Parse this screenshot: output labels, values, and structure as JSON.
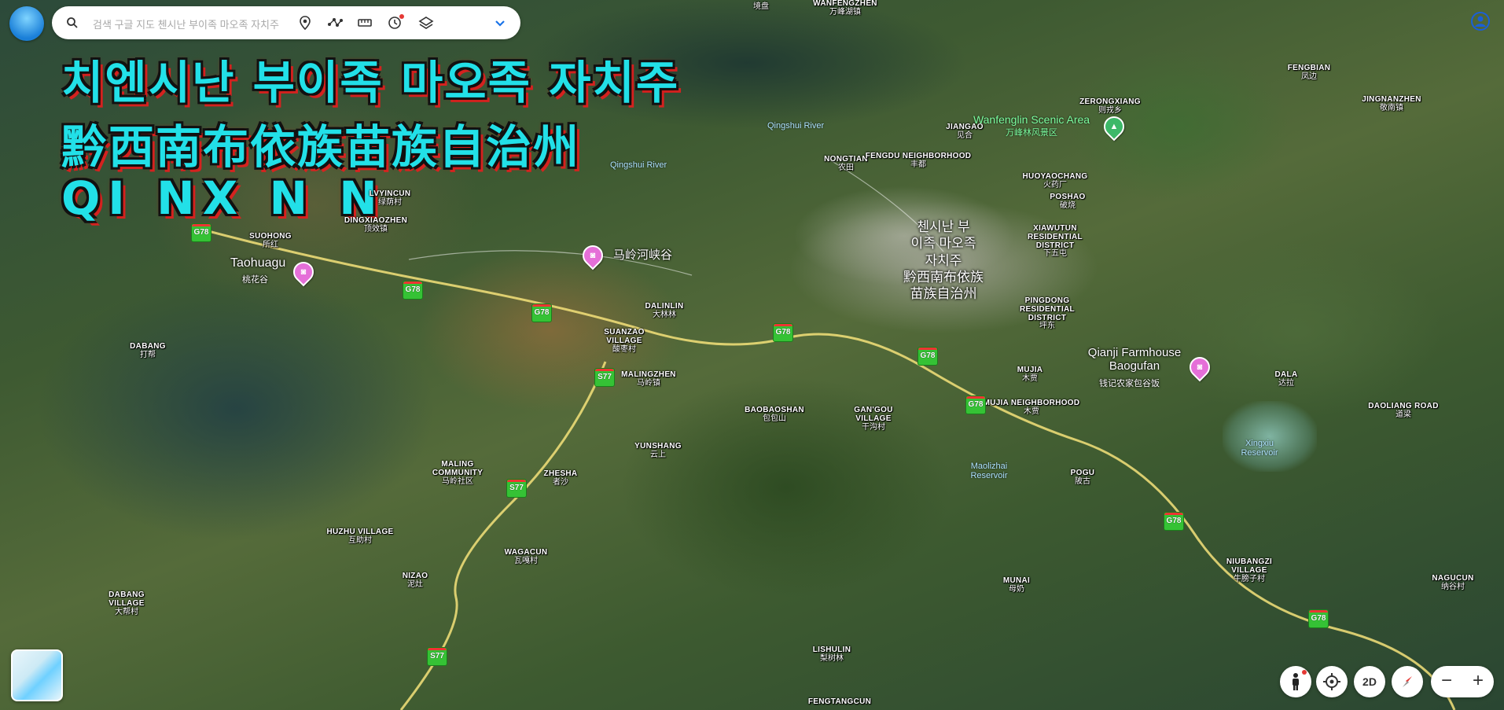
{
  "search": {
    "placeholder": "검색 구글 지도 첸시난 부이족 마오족 자치주"
  },
  "overlay_title": {
    "line1": "치엔시난 부이족 마오족 자치주",
    "line2": "黔西南布依族苗族自治州",
    "line3": "QI NX  N N"
  },
  "city_label": {
    "ko_1": "첸시난 부",
    "ko_2": "이족 마오족",
    "ko_3": "자치주",
    "zh_1": "黔西南布依族",
    "zh_2": "苗族自治州"
  },
  "places": [
    {
      "en": "WANFENGZHEN",
      "zh": "万峰湖镇"
    },
    {
      "en": "",
      "zh": "境盘"
    },
    {
      "en": "FENGBIAN",
      "zh": "凤边"
    },
    {
      "en": "JINGNANZHEN",
      "zh": "敬南镇"
    },
    {
      "en": "ZERONGXIANG",
      "zh": "则戎乡"
    },
    {
      "en": "JIANGAO",
      "zh": "见合"
    },
    {
      "en": "NONGTIAN",
      "zh": "农田"
    },
    {
      "en": "FENGDU NEIGHBORHOOD",
      "zh": "丰都"
    },
    {
      "en": "HUOYAOCHANG",
      "zh": "火药厂"
    },
    {
      "en": "POSHAO",
      "zh": "破烧"
    },
    {
      "en": "XIAWUTUN RESIDENTIAL DISTRICT",
      "zh": "下五屯"
    },
    {
      "en": "LVYINCUN",
      "zh": "绿荫村"
    },
    {
      "en": "DINGXIAOZHEN",
      "zh": "顶效镇"
    },
    {
      "en": "SUOHONG",
      "zh": "所红"
    },
    {
      "en": "DALINLIN",
      "zh": "大林林"
    },
    {
      "en": "SUANZAO VILLAGE",
      "zh": "酸枣村"
    },
    {
      "en": "MALINGZHEN",
      "zh": "马岭镇"
    },
    {
      "en": "PINGDONG RESIDENTIAL DISTRICT",
      "zh": "坪东"
    },
    {
      "en": "MUJIA",
      "zh": "木贾"
    },
    {
      "en": "MUJIA NEIGHBORHOOD",
      "zh": "木贾"
    },
    {
      "en": "DABANG",
      "zh": "打帮"
    },
    {
      "en": "BAOBAOSHAN",
      "zh": "包包山"
    },
    {
      "en": "GAN'GOU VILLAGE",
      "zh": "干沟村"
    },
    {
      "en": "YUNSHANG",
      "zh": "云上"
    },
    {
      "en": "MALING COMMUNITY",
      "zh": "马岭社区"
    },
    {
      "en": "ZHESHA",
      "zh": "者沙"
    },
    {
      "en": "DALA",
      "zh": "达拉"
    },
    {
      "en": "DAOLIANG ROAD",
      "zh": "道梁"
    },
    {
      "en": "POGU",
      "zh": "陂古"
    },
    {
      "en": "HUZHU VILLAGE",
      "zh": "互助村"
    },
    {
      "en": "WAGACUN",
      "zh": "瓦嘎村"
    },
    {
      "en": "NIZAO",
      "zh": "泥灶"
    },
    {
      "en": "DABANG VILLAGE",
      "zh": "大帮村"
    },
    {
      "en": "MUNAI",
      "zh": "母奶"
    },
    {
      "en": "NIUBANGZI VILLAGE",
      "zh": "牛膀子村"
    },
    {
      "en": "NAGUCUN",
      "zh": "纳谷村"
    },
    {
      "en": "LISHULIN",
      "zh": "梨树林"
    },
    {
      "en": "FENGTANGCUN",
      "zh": ""
    }
  ],
  "water": [
    "Qingshui River",
    "Qingshui River",
    "Xingxiu Reservoir",
    "Maolizhai Reservoir"
  ],
  "scenic": {
    "en": "Wanfenglin Scenic Area",
    "zh": "万峰林风景区"
  },
  "pois": [
    {
      "label": "Taohuagu",
      "sub": "桃花谷"
    },
    {
      "label": "马岭河峡谷",
      "sub": ""
    },
    {
      "label": "Qianji Farmhouse Baogufan",
      "sub": "钱记农家包谷饭"
    }
  ],
  "highways": [
    "G78",
    "G78",
    "G78",
    "G78",
    "G78",
    "G78",
    "G78",
    "G78",
    "S77",
    "S77",
    "S77"
  ],
  "controls": {
    "mode": "2D"
  },
  "colors": {
    "title_fill": "#22e0e8",
    "title_shadow": "#e61e1e",
    "shield": "#35c235",
    "poi": "#e56fd8"
  }
}
